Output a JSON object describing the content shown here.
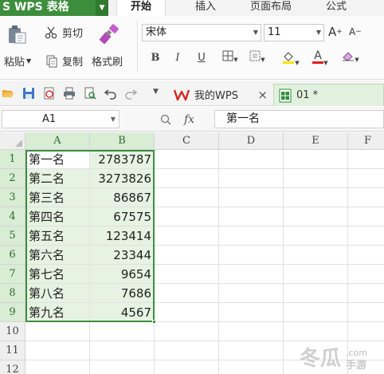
{
  "app": {
    "title": "S WPS 表格"
  },
  "ribbon_tabs": [
    {
      "label": "开始",
      "active": true
    },
    {
      "label": "插入",
      "active": false
    },
    {
      "label": "页面布局",
      "active": false
    },
    {
      "label": "公式",
      "active": false
    }
  ],
  "clipboard": {
    "paste": "粘贴",
    "cut": "剪切",
    "copy": "复制",
    "format_painter": "格式刷"
  },
  "font": {
    "name": "宋体",
    "size": "11",
    "bold": "B",
    "italic": "I",
    "underline": "U",
    "grow": "A",
    "shrink": "A",
    "font_color_letter": "A"
  },
  "colors": {
    "accent_green": "#3e8d3e",
    "app_title_bg": "#3c8e3c",
    "highlight_yellow": "#f5e400",
    "font_red": "#e02020",
    "selection_fill": "#e6f3e2"
  },
  "doc_tabs": [
    {
      "label": "我的WPS",
      "icon": "wps-logo-icon",
      "close": "×"
    },
    {
      "label": "01 *",
      "icon": "spreadsheet-file-icon",
      "active": true
    }
  ],
  "formula_bar": {
    "cell_ref": "A1",
    "fx": "fx",
    "value": "第一名"
  },
  "grid": {
    "columns": [
      "A",
      "B",
      "C",
      "D",
      "E",
      "F"
    ],
    "rows": [
      "1",
      "2",
      "3",
      "4",
      "5",
      "6",
      "7",
      "8",
      "9",
      "10",
      "11",
      "12"
    ],
    "data": [
      {
        "a": "第一名",
        "b": "2783787"
      },
      {
        "a": "第二名",
        "b": "3273826"
      },
      {
        "a": "第三名",
        "b": "86867"
      },
      {
        "a": "第四名",
        "b": "67575"
      },
      {
        "a": "第五名",
        "b": "123414"
      },
      {
        "a": "第六名",
        "b": "23344"
      },
      {
        "a": "第七名",
        "b": "9654"
      },
      {
        "a": "第八名",
        "b": "7686"
      },
      {
        "a": "第九名",
        "b": "4567"
      }
    ],
    "selection": "A1:B9",
    "active_cell": "A1"
  },
  "watermark": {
    "brand": "冬瓜",
    "domain": ".com",
    "suffix": "手游"
  }
}
